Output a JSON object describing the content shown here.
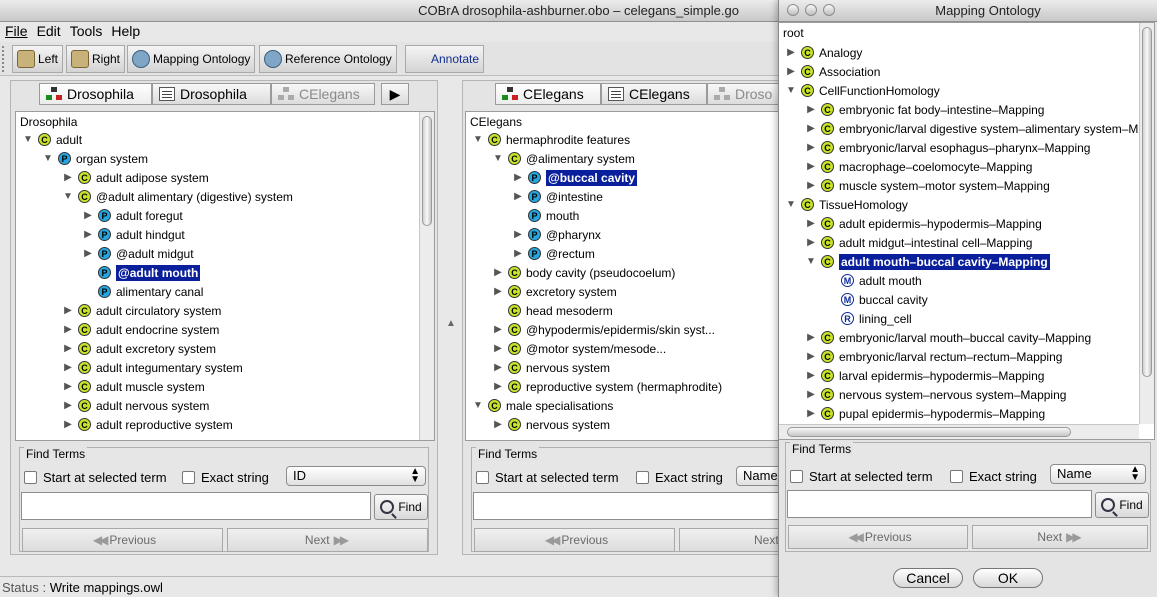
{
  "main": {
    "title": "COBrA  drosophila-ashburner.obo – celegans_simple.go",
    "menu": [
      "File",
      "Edit",
      "Tools",
      "Help"
    ],
    "toolbar": {
      "left": "Left",
      "right": "Right",
      "mapping": "Mapping Ontology",
      "reference": "Reference Ontology",
      "annotate": "Annotate"
    },
    "status_key": "Status",
    "status_sep": ":",
    "status_value": "Write mappings.owl"
  },
  "left_panel": {
    "tabs": [
      "Drosophila",
      "Drosophila",
      "CElegans"
    ],
    "root": "Drosophila",
    "nodes": [
      {
        "label": "adult",
        "badge": "C"
      },
      {
        "label": "organ system",
        "badge": "P"
      },
      {
        "label": "adult adipose system",
        "badge": "C"
      },
      {
        "label": "@adult alimentary (digestive) system",
        "badge": "C"
      },
      {
        "label": "adult foregut",
        "badge": "P"
      },
      {
        "label": "adult hindgut",
        "badge": "P"
      },
      {
        "label": "@adult midgut",
        "badge": "P"
      },
      {
        "label": "@adult mouth",
        "badge": "P"
      },
      {
        "label": "alimentary canal",
        "badge": "P"
      },
      {
        "label": "adult circulatory system",
        "badge": "C"
      },
      {
        "label": "adult endocrine system",
        "badge": "C"
      },
      {
        "label": "adult excretory system",
        "badge": "C"
      },
      {
        "label": "adult integumentary system",
        "badge": "C"
      },
      {
        "label": "adult muscle system",
        "badge": "C"
      },
      {
        "label": "adult nervous system",
        "badge": "C"
      },
      {
        "label": "adult reproductive system",
        "badge": "C"
      }
    ],
    "find": {
      "legend": "Find Terms",
      "start_at_selected": "Start at selected term",
      "exact_string": "Exact string",
      "select_value": "ID",
      "find_label": "Find",
      "previous": "Previous",
      "next": "Next"
    }
  },
  "right_panel": {
    "tabs": [
      "CElegans",
      "CElegans",
      "Droso"
    ],
    "root": "CElegans",
    "nodes": [
      {
        "label": "hermaphrodite features",
        "badge": "C"
      },
      {
        "label": "@alimentary system",
        "badge": "C"
      },
      {
        "label": "@buccal cavity",
        "badge": "P"
      },
      {
        "label": "@intestine",
        "badge": "P"
      },
      {
        "label": "mouth",
        "badge": "P"
      },
      {
        "label": "@pharynx",
        "badge": "P"
      },
      {
        "label": "@rectum",
        "badge": "P"
      },
      {
        "label": "body cavity (pseudocoelum)",
        "badge": "C"
      },
      {
        "label": "excretory system",
        "badge": "C"
      },
      {
        "label": "head mesoderm",
        "badge": "C"
      },
      {
        "label": "@hypodermis/epidermis/skin syst...",
        "badge": "C"
      },
      {
        "label": "@motor system/mesode...",
        "badge": "C"
      },
      {
        "label": "nervous system",
        "badge": "C"
      },
      {
        "label": "reproductive system (hermaphrodite)",
        "badge": "C"
      },
      {
        "label": "male specialisations",
        "badge": "C"
      },
      {
        "label": "nervous system",
        "badge": "C"
      }
    ],
    "find": {
      "legend": "Find Terms",
      "start_at_selected": "Start at selected term",
      "exact_string": "Exact string",
      "select_value": "Name",
      "previous": "Previous",
      "next": "Next"
    }
  },
  "dialog": {
    "title": "Mapping Ontology",
    "root": "root",
    "nodes": [
      {
        "label": "Analogy",
        "badge": "C"
      },
      {
        "label": "Association",
        "badge": "C"
      },
      {
        "label": "CellFunctionHomology",
        "badge": "C"
      },
      {
        "label": "embryonic fat body–intestine–Mapping",
        "badge": "C"
      },
      {
        "label": "embryonic/larval digestive system–alimentary system–M",
        "badge": "C"
      },
      {
        "label": "embryonic/larval esophagus–pharynx–Mapping",
        "badge": "C"
      },
      {
        "label": "macrophage–coelomocyte–Mapping",
        "badge": "C"
      },
      {
        "label": "muscle system–motor system–Mapping",
        "badge": "C"
      },
      {
        "label": "TissueHomology",
        "badge": "C"
      },
      {
        "label": "adult epidermis–hypodermis–Mapping",
        "badge": "C"
      },
      {
        "label": "adult midgut–intestinal cell–Mapping",
        "badge": "C"
      },
      {
        "label": "adult mouth–buccal cavity–Mapping",
        "badge": "C"
      },
      {
        "label": "adult mouth",
        "badge": "M"
      },
      {
        "label": "buccal cavity",
        "badge": "M"
      },
      {
        "label": "lining_cell",
        "badge": "R"
      },
      {
        "label": "embryonic/larval mouth–buccal cavity–Mapping",
        "badge": "C"
      },
      {
        "label": "embryonic/larval rectum–rectum–Mapping",
        "badge": "C"
      },
      {
        "label": "larval epidermis–hypodermis–Mapping",
        "badge": "C"
      },
      {
        "label": "nervous system–nervous system–Mapping",
        "badge": "C"
      },
      {
        "label": "pupal epidermis–hypodermis–Mapping",
        "badge": "C"
      }
    ],
    "find": {
      "legend": "Find Terms",
      "start_at_selected": "Start at selected term",
      "exact_string": "Exact string",
      "select_value": "Name",
      "find_label": "Find",
      "previous": "Previous",
      "next": "Next"
    },
    "cancel": "Cancel",
    "ok": "OK"
  }
}
